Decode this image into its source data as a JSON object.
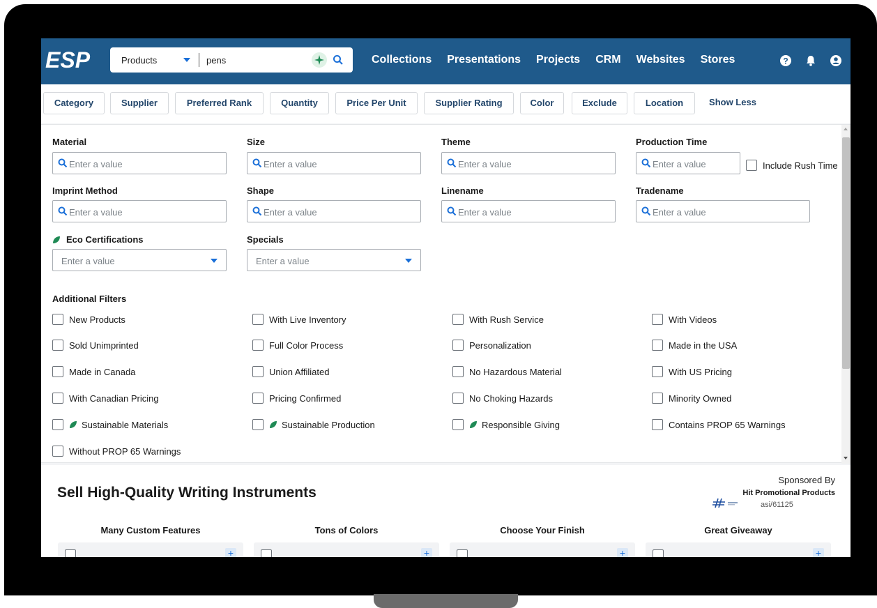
{
  "header": {
    "logo_text": "ESP",
    "search": {
      "category": "Products",
      "query": "pens"
    },
    "nav": [
      "Collections",
      "Presentations",
      "Projects",
      "CRM",
      "Websites",
      "Stores"
    ],
    "icons": [
      "help-icon",
      "bell-icon",
      "user-icon"
    ]
  },
  "chips": [
    "Category",
    "Supplier",
    "Preferred Rank",
    "Quantity",
    "Price Per Unit",
    "Supplier Rating",
    "Color",
    "Exclude",
    "Location",
    "Show Less"
  ],
  "filters": {
    "material": {
      "label": "Material",
      "placeholder": "Enter a value"
    },
    "size": {
      "label": "Size",
      "placeholder": "Enter a value"
    },
    "theme": {
      "label": "Theme",
      "placeholder": "Enter a value"
    },
    "production_time": {
      "label": "Production Time",
      "placeholder": "Enter a value",
      "rush_label": "Include Rush Time"
    },
    "imprint_method": {
      "label": "Imprint Method",
      "placeholder": "Enter a value"
    },
    "shape": {
      "label": "Shape",
      "placeholder": "Enter a value"
    },
    "linename": {
      "label": "Linename",
      "placeholder": "Enter a value"
    },
    "tradename": {
      "label": "Tradename",
      "placeholder": "Enter a value"
    },
    "eco_certifications": {
      "label": "Eco Certifications",
      "placeholder": "Enter a value"
    },
    "specials": {
      "label": "Specials",
      "placeholder": "Enter a value"
    }
  },
  "additional_filters": {
    "title": "Additional Filters",
    "items": [
      [
        "New Products",
        "With Live Inventory",
        "With Rush Service",
        "With Videos"
      ],
      [
        "Sold Unimprinted",
        "Full Color Process",
        "Personalization",
        "Made in the USA"
      ],
      [
        "Made in Canada",
        "Union Affiliated",
        "No Hazardous Material",
        "With US Pricing"
      ],
      [
        "With Canadian Pricing",
        "Pricing Confirmed",
        "No Choking Hazards",
        "Minority Owned"
      ],
      [
        "Sustainable Materials",
        "Sustainable Production",
        "Responsible Giving",
        "Contains PROP 65 Warnings"
      ],
      [
        "Without PROP 65 Warnings"
      ]
    ]
  },
  "sponsored": {
    "title": "Sell High-Quality Writing Instruments",
    "by_label": "Sponsored By",
    "supplier_name": "Hit Promotional Products",
    "asi": "asi/61125",
    "features": [
      "Many Custom Features",
      "Tons of Colors",
      "Choose Your Finish",
      "Great Giveaway"
    ]
  },
  "colors": {
    "nav_bg": "#1f5a8b",
    "accent": "#1a6fd8",
    "chip_text": "#23466b",
    "eco_green": "#1f8a55"
  }
}
